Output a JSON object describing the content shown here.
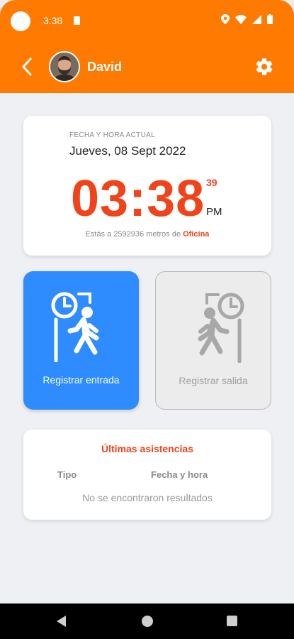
{
  "status_bar": {
    "time": "3:38"
  },
  "app_bar": {
    "user_name": "David",
    "avatar": "user-photo"
  },
  "clock_card": {
    "caption": "FECHA Y HORA ACTUAL",
    "date": "Jueves, 08 Sept 2022",
    "time": "03:38",
    "seconds": "39",
    "ampm": "PM",
    "distance_prefix": "Estás a 2592936 metros de ",
    "place": "Oficina"
  },
  "actions": {
    "check_in_label": "Registrar entrada",
    "check_out_label": "Registrar salida"
  },
  "attendance": {
    "title": "Últimas asistencias",
    "col_type": "Tipo",
    "col_datetime": "Fecha y hora",
    "empty": "No se encontraron resultados"
  },
  "colors": {
    "primary": "#ff7a00",
    "accent": "#f0431a",
    "check_in": "#2f8cff",
    "disabled": "#a0a0a0"
  },
  "icons": [
    "camera-dot",
    "sim-icon",
    "location-icon",
    "wifi-icon",
    "signal-icon",
    "battery-icon",
    "back-arrow-icon",
    "settings-gear-icon",
    "clock-walk-in-icon",
    "clock-walk-out-icon"
  ]
}
